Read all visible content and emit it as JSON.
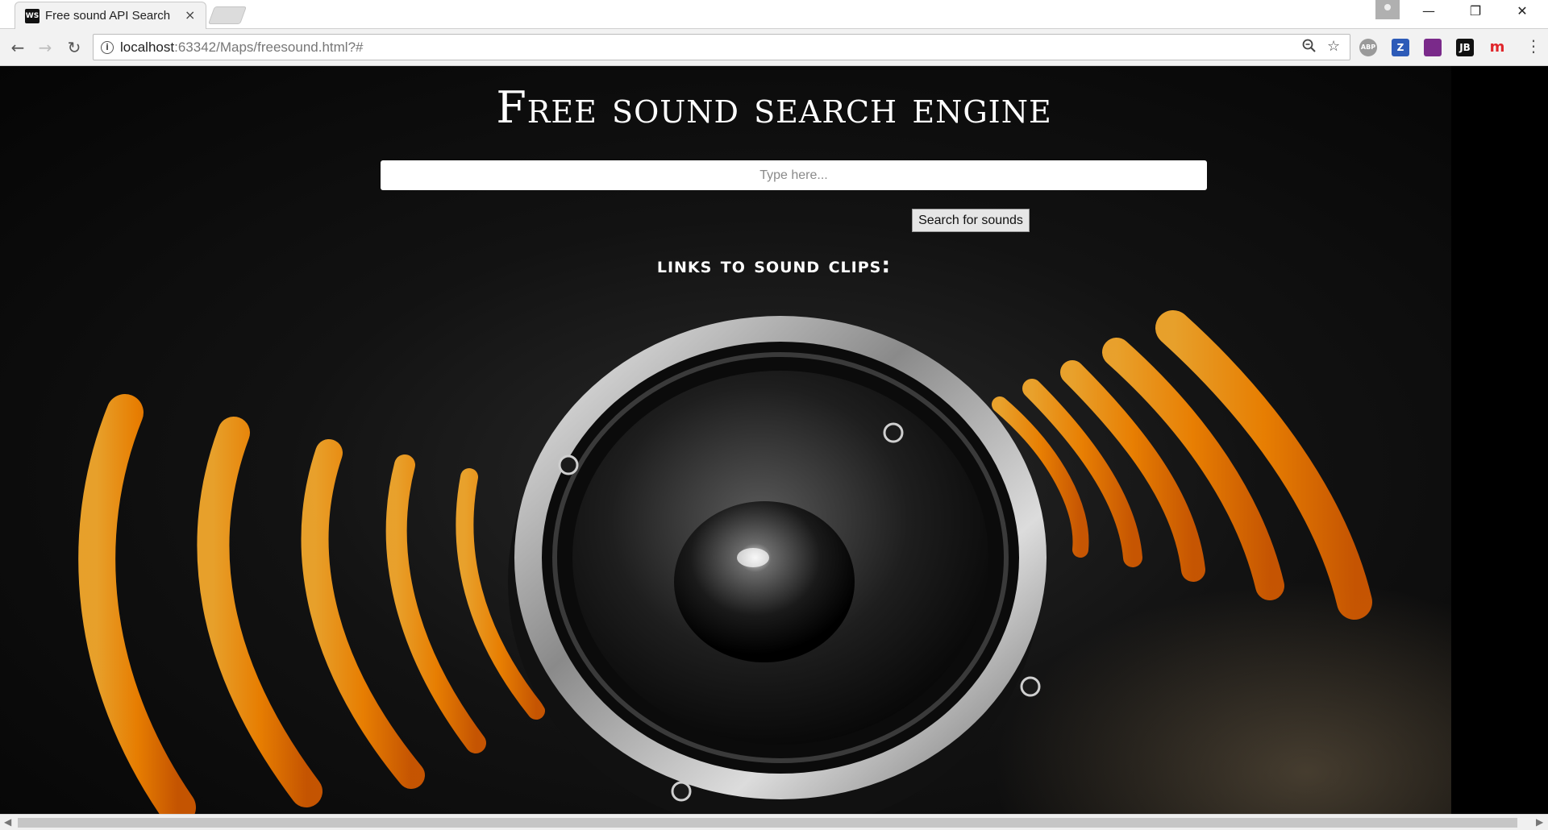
{
  "browser": {
    "tab_title": "Free sound API Search",
    "tab_favicon": "WS",
    "tab_close": "×",
    "url_host": "localhost",
    "url_path": ":63342/Maps/freesound.html?#",
    "info_icon": "i",
    "extensions": [
      {
        "name": "abp-extension-icon",
        "label": "ABP",
        "color": "#9a9a9a"
      },
      {
        "name": "z-extension-icon",
        "label": "Z",
        "color": "#2d5bb8"
      },
      {
        "name": "bookmark-extension-icon",
        "label": "",
        "color": "#7a2a8a"
      },
      {
        "name": "jetbrains-extension-icon",
        "label": "JB",
        "color": "#111111"
      },
      {
        "name": "m-extension-icon",
        "label": "m",
        "color": "#e0262b"
      }
    ]
  },
  "page": {
    "title": "Free sound search engine",
    "search_placeholder": "Type here...",
    "search_button": "Search for sounds",
    "links_heading": "links to sound clips:"
  },
  "colors": {
    "wave_orange": "#ff8c00",
    "wave_highlight": "#ffd27a",
    "background": "#0a0a0a"
  }
}
